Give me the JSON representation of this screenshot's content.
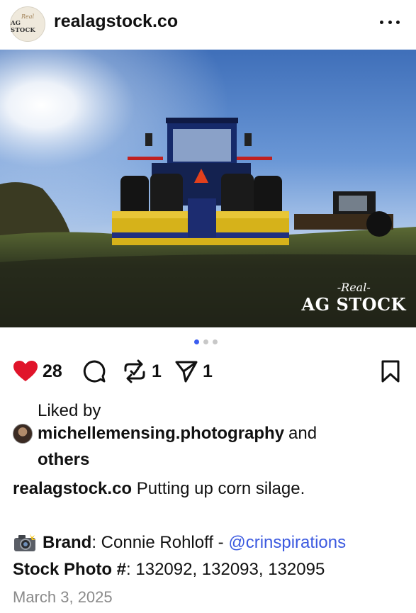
{
  "post": {
    "username": "realagstock.co",
    "avatar_text_small": "Real",
    "avatar_text_big": "AG STOCK",
    "watermark_small": "-Real-",
    "watermark_big": "AG STOCK",
    "carousel": {
      "count": 3,
      "active": 0
    }
  },
  "actions": {
    "likes": "28",
    "reposts": "1",
    "shares": "1",
    "like_color": "#e0142a"
  },
  "likes_info": {
    "liked_by": "Liked by",
    "liker": "michellemensing.photography",
    "and": "and",
    "others": "others"
  },
  "caption": {
    "user": "realagstock.co",
    "text": "Putting up corn silage."
  },
  "credits": {
    "camera_icon": "camera-flash-emoji",
    "brand_label": "Brand",
    "brand_value": ": Connie Rohloff - ",
    "brand_handle": "@crinspirations",
    "stock_label": "Stock Photo #",
    "stock_value": ": 132092, 132093, 132095"
  },
  "date": "March 3, 2025",
  "colors": {
    "link": "#3c5ae0",
    "dot_active": "#3b5df0"
  }
}
